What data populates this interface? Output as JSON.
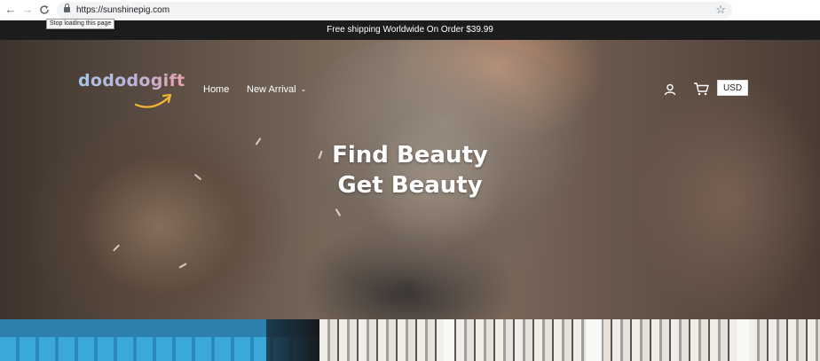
{
  "browser": {
    "url": "https://sunshinepig.com",
    "tooltip": "Stop loading this page",
    "icons": [
      "back-icon",
      "forward-icon",
      "stop-reload-icon",
      "lock-icon",
      "bookmark-star-icon"
    ]
  },
  "announcement": {
    "text": "Free shipping Worldwide On Order $39.99"
  },
  "header": {
    "logo_text": "dododogift",
    "nav": [
      {
        "label": "Home"
      },
      {
        "label": "New Arrival"
      }
    ],
    "currency": "USD",
    "icons": [
      "account-icon",
      "cart-icon",
      "chevron-down-icon"
    ]
  },
  "hero": {
    "line1": "Find Beauty",
    "line2": "Get Beauty"
  },
  "colors": {
    "announcement_bg": "#1c1c1c",
    "logo_gradient_start": "#a8c4e6",
    "logo_gradient_end": "#e8a2b0",
    "logo_arrow": "#f2b531"
  }
}
